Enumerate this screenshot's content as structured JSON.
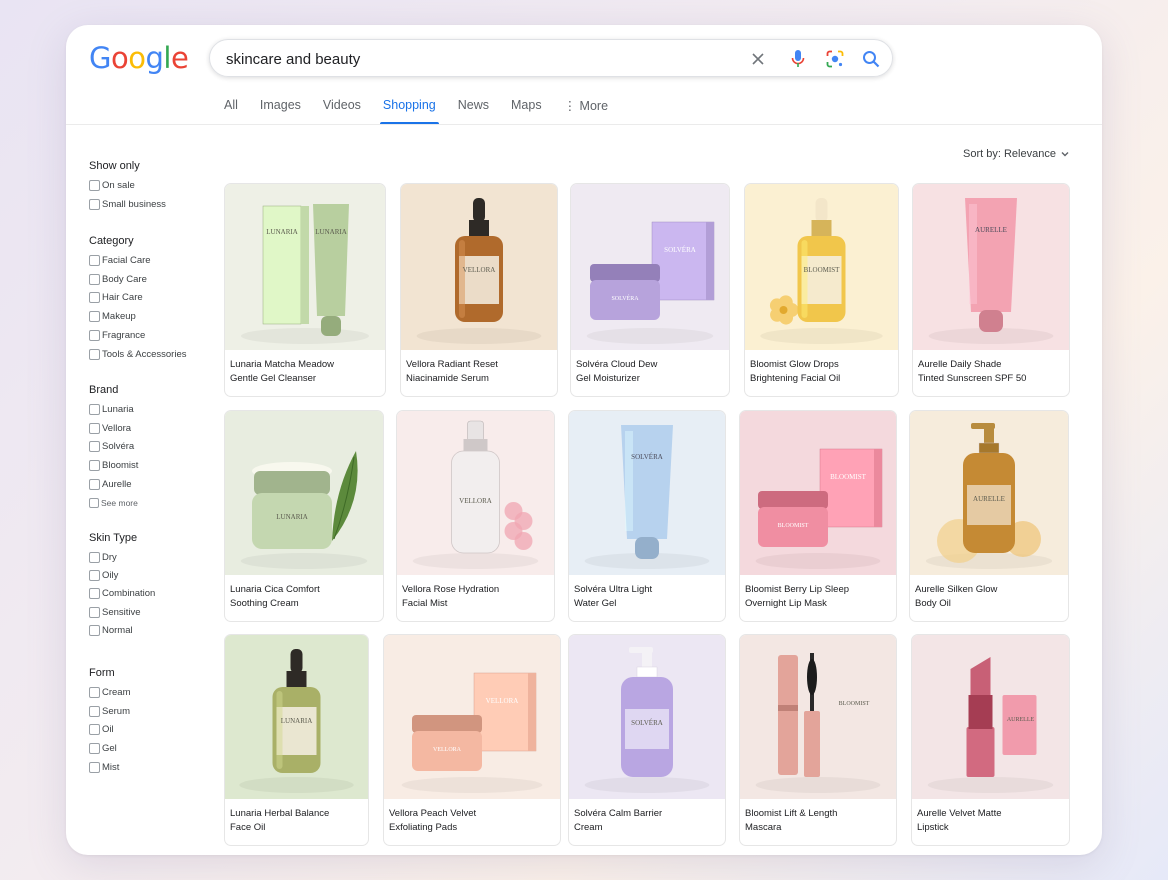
{
  "logo": {
    "letters": [
      "G",
      "o",
      "o",
      "g",
      "l",
      "e"
    ],
    "colors": [
      "#4285F4",
      "#EA4335",
      "#FBBC05",
      "#4285F4",
      "#34A853",
      "#EA4335"
    ]
  },
  "search": {
    "query": "skincare and beauty",
    "icons": [
      "clear-icon",
      "microphone-icon",
      "lens-icon",
      "search-icon"
    ]
  },
  "tabs": [
    {
      "label": "All",
      "active": false
    },
    {
      "label": "Images",
      "active": false
    },
    {
      "label": "Videos",
      "active": false
    },
    {
      "label": "Shopping",
      "active": true
    },
    {
      "label": "News",
      "active": false
    },
    {
      "label": "Maps",
      "active": false
    },
    {
      "label": "⋮ More",
      "active": false
    }
  ],
  "sort": {
    "label": "Sort by: Relevance",
    "icon": "chevron-down-icon"
  },
  "filters": {
    "show_only": {
      "title": "Show only",
      "items": [
        "On sale",
        "Small business"
      ]
    },
    "category": {
      "title": "Category",
      "items": [
        "Facial Care",
        "Body Care",
        "Hair Care",
        "Makeup",
        "Fragrance",
        "Tools & Accessories"
      ]
    },
    "brand": {
      "title": "Brand",
      "items": [
        "Lunaria",
        "Vellora",
        "Solvéra",
        "Bloomist",
        "Aurelle"
      ],
      "see_more": "See more"
    },
    "skin_type": {
      "title": "Skin Type",
      "items": [
        "Dry",
        "Oily",
        "Combination",
        "Sensitive",
        "Normal"
      ]
    },
    "form": {
      "title": "Form",
      "items": [
        "Cream",
        "Serum",
        "Oil",
        "Gel",
        "Mist"
      ]
    }
  },
  "products": [
    {
      "line1": "Lunaria Matcha Meadow",
      "line2": "Gentle Gel Cleanser",
      "label": "LUNARIA",
      "bg": "#eef0e6",
      "product": "#b8cf9f",
      "kind": "tube-box"
    },
    {
      "line1": "Vellora Radiant Reset",
      "line2": "Niacinamide Serum",
      "label": "VELLORA",
      "bg": "#f2e4d2",
      "product": "#b06a2c",
      "kind": "dropper"
    },
    {
      "line1": "Solvéra Cloud Dew",
      "line2": "Gel Moisturizer",
      "label": "SOLVÉRA",
      "bg": "#efeaf2",
      "product": "#b7a3dc",
      "kind": "jar-box"
    },
    {
      "line1": "Bloomist Glow Drops",
      "line2": "Brightening Facial Oil",
      "label": "BLOOMIST",
      "bg": "#fbf0d2",
      "product": "#f1c64b",
      "kind": "dropper-flower"
    },
    {
      "line1": "Aurelle Daily Shade",
      "line2": "Tinted Sunscreen SPF 50",
      "label": "AURELLE",
      "bg": "#f7e1e3",
      "product": "#f3a3b2",
      "kind": "tube"
    },
    {
      "line1": "Lunaria Cica Comfort",
      "line2": "Soothing Cream",
      "label": "LUNARIA",
      "bg": "#e8ede0",
      "product": "#c4d7b0",
      "kind": "jar-leaf"
    },
    {
      "line1": "Vellora Rose Hydration",
      "line2": "Facial Mist",
      "label": "VELLORA",
      "bg": "#f8eceb",
      "product": "#f2eeee",
      "kind": "mist"
    },
    {
      "line1": "Solvéra Ultra Light",
      "line2": "Water Gel",
      "label": "SOLVÉRA",
      "bg": "#e7eef5",
      "product": "#b7d2ee",
      "kind": "tube"
    },
    {
      "line1": "Bloomist Berry Lip Sleep",
      "line2": "Overnight Lip Mask",
      "label": "BLOOMIST",
      "bg": "#f4d9dd",
      "product": "#f08ea2",
      "kind": "jar-box"
    },
    {
      "line1": "Aurelle Silken Glow",
      "line2": "Body Oil",
      "label": "AURELLE",
      "bg": "#f6ecdc",
      "product": "#c58a34",
      "kind": "pump"
    },
    {
      "line1": "Lunaria Herbal Balance",
      "line2": "Face Oil",
      "label": "LUNARIA",
      "bg": "#dde8cf",
      "product": "#a9b067",
      "kind": "dropper"
    },
    {
      "line1": "Vellora Peach Velvet",
      "line2": "Exfoliating Pads",
      "label": "VELLORA",
      "bg": "#f8ece4",
      "product": "#f4b8a2",
      "kind": "jar-box"
    },
    {
      "line1": "Solvéra Calm Barrier",
      "line2": "Cream",
      "label": "SOLVÉRA",
      "bg": "#ece7f3",
      "product": "#b9a6e2",
      "kind": "pump"
    },
    {
      "line1": "Bloomist Lift & Length",
      "line2": "Mascara",
      "label": "BLOOMIST",
      "bg": "#f3e7e3",
      "product": "#e3a49a",
      "kind": "mascara"
    },
    {
      "line1": "Aurelle Velvet Matte",
      "line2": "Lipstick",
      "label": "AURELLE",
      "bg": "#f3e5e6",
      "product": "#c86076",
      "kind": "lipstick"
    }
  ]
}
